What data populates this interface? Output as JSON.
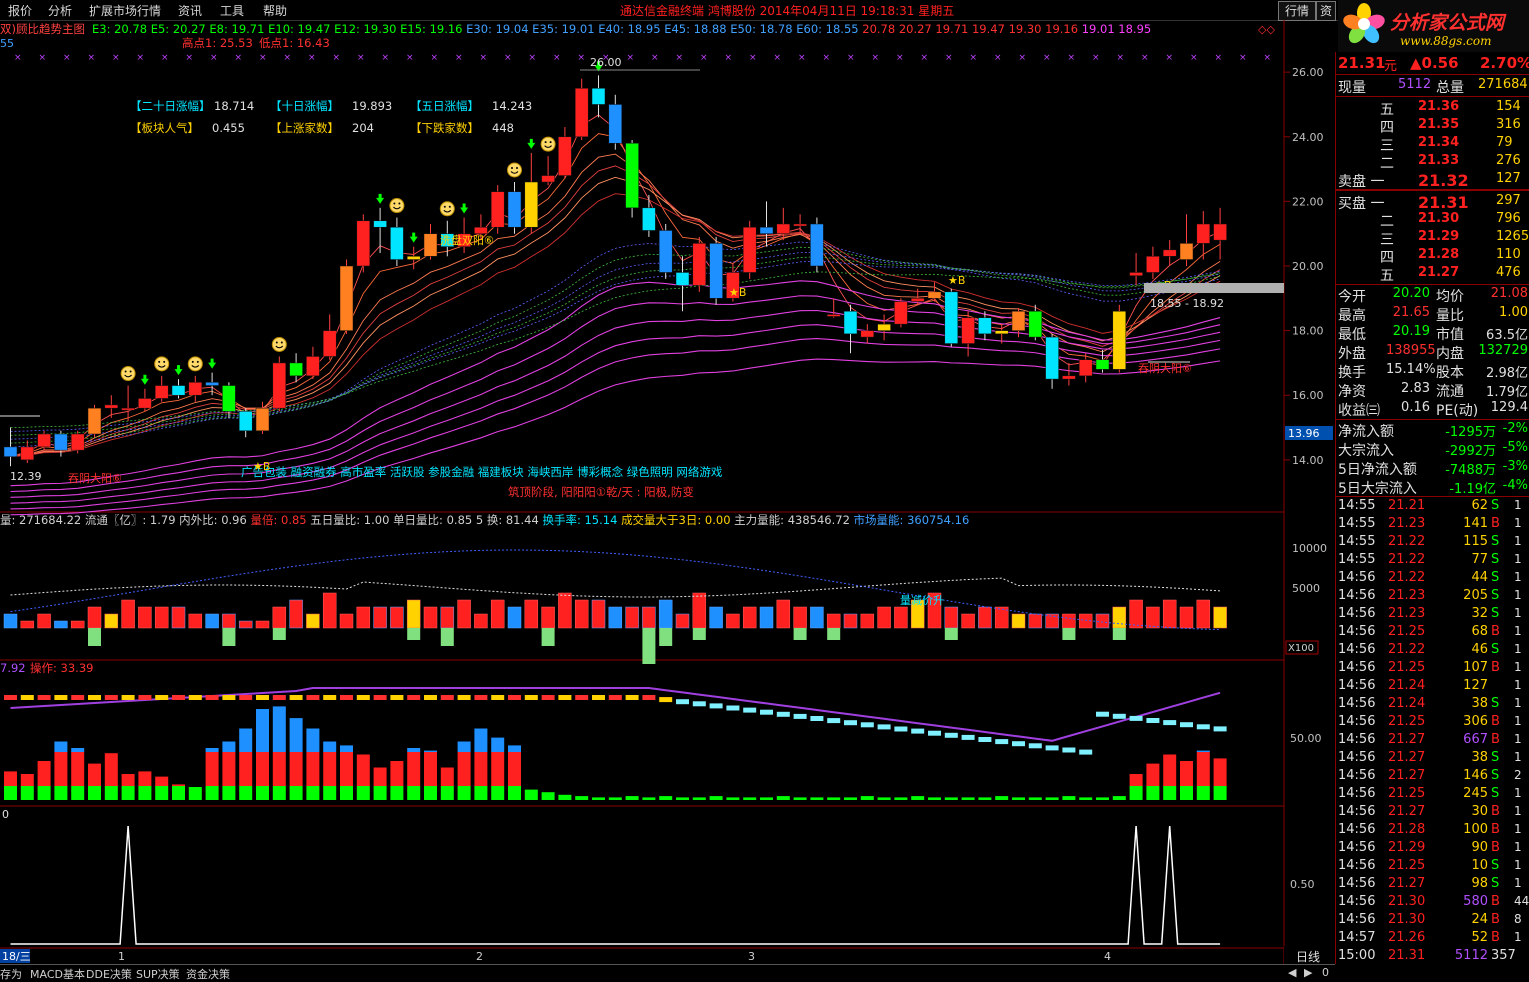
{
  "menu": [
    "报价",
    "分析",
    "扩展市场行情",
    "资讯",
    "工具",
    "帮助"
  ],
  "title_center": "通达信金融终端   鸿博股份  2014年04月11日  19:18:31  星期五",
  "buttons": {
    "hangqing": "行情",
    "zixun": "资"
  },
  "logo": {
    "text": "分析家公式网",
    "url": "www.88gs.com"
  },
  "indicator_line": {
    "name": "双)顾比趋势主图",
    "items": [
      {
        "t": "E3: 20.78",
        "c": "#00ff00"
      },
      {
        "t": "E5: 20.27",
        "c": "#00ff00"
      },
      {
        "t": "E8: 19.71",
        "c": "#00ff00"
      },
      {
        "t": "E10: 19.47",
        "c": "#00ff00"
      },
      {
        "t": "E12: 19.30",
        "c": "#00ff00"
      },
      {
        "t": "E15: 19.16",
        "c": "#00ff00"
      },
      {
        "t": "E30: 19.04",
        "c": "#40a0ff"
      },
      {
        "t": "E35: 19.01",
        "c": "#40a0ff"
      },
      {
        "t": "E40: 18.95",
        "c": "#40a0ff"
      },
      {
        "t": "E45: 18.88",
        "c": "#40a0ff"
      },
      {
        "t": "E50: 18.78",
        "c": "#40a0ff"
      },
      {
        "t": "E60: 18.55",
        "c": "#40a0ff"
      },
      {
        "t": "20.78",
        "c": "#ff3030"
      },
      {
        "t": "20.27",
        "c": "#ff3030"
      },
      {
        "t": "19.71",
        "c": "#ff3030"
      },
      {
        "t": "19.47",
        "c": "#ff3030"
      },
      {
        "t": "19.30",
        "c": "#ff3030"
      },
      {
        "t": "19.16",
        "c": "#ff3030"
      },
      {
        "t": "19.01",
        "c": "#ff40ff"
      },
      {
        "t": "18.95",
        "c": "#ff40ff"
      }
    ]
  },
  "highlow": {
    "high": "高点1: 25.53",
    "low": "低点1: 16.43"
  },
  "left_stub": "55",
  "stats_box": [
    [
      {
        "k": "【二十日涨幅】",
        "v": "18.714"
      },
      {
        "k": "【十日涨幅】",
        "v": "19.893"
      },
      {
        "k": "【五日涨幅】",
        "v": "14.243"
      }
    ],
    [
      {
        "k": "【板块人气】",
        "v": "0.455"
      },
      {
        "k": "【上涨家数】",
        "v": "204"
      },
      {
        "k": "【下跌家数】",
        "v": "448"
      }
    ]
  ],
  "annotations": {
    "peak": "26.00",
    "wash": "洗盘双阳⑥",
    "tunyin_left": "吞阴大阳⑥",
    "tunyin_right": "吞阴大阳⑥",
    "range_label": "18.55 - 18.92",
    "left_low": "12.39",
    "concepts": "广告包装 融资融券 高市盈率 活跃股 参股金融 福建板块 海峡西岸 博彩概念 绿色照明 网络游戏",
    "stage": "筑顶阶段, 阳阳阳①乾/天 : 阳极,防变",
    "star_b": "★B",
    "vol_label": "量减价升",
    "x100": "X100",
    "price_tag": "13.96"
  },
  "price_axis": [
    "26.00",
    "24.00",
    "22.00",
    "20.00",
    "18.00",
    "16.00",
    "14.00"
  ],
  "volume_line": [
    {
      "t": "量: 271684.22",
      "c": "#d0d0d0"
    },
    {
      "t": "流通〖亿〗: 1.79",
      "c": "#d0d0d0"
    },
    {
      "t": "内外比: 0.96",
      "c": "#d0d0d0"
    },
    {
      "t": "量倍: 0.85",
      "c": "#ff3030"
    },
    {
      "t": "五日量比: 1.00",
      "c": "#d0d0d0"
    },
    {
      "t": "单日量比: 0.85",
      "c": "#d0d0d0"
    },
    {
      "t": "5 换: 81.44",
      "c": "#d0d0d0"
    },
    {
      "t": "换手率: 15.14",
      "c": "#00e5ff"
    },
    {
      "t": "成交量大于3日: 0.00",
      "c": "#ffd200"
    },
    {
      "t": "主力量能: 438546.72",
      "c": "#d0d0d0"
    },
    {
      "t": "市场量能: 360754.16",
      "c": "#40a0ff"
    }
  ],
  "volume_axis": [
    "10000",
    "5000"
  ],
  "op_line": {
    "v1": "7.92",
    "label": "操作: 33.39"
  },
  "op_axis": [
    "50.00"
  ],
  "signal_axis": [
    "0.50"
  ],
  "signal_stub": "0",
  "date_axis": {
    "left": "18/三",
    "m1": "1",
    "m2": "2",
    "m3": "3",
    "m4": "4"
  },
  "bottom_tabs": [
    "存为",
    "MACD基本",
    "DDE决策",
    "SUP决策",
    "资金决策"
  ],
  "period": "日线",
  "quote": {
    "price": "21.31",
    "unit": "元",
    "change": "▲0.56",
    "pct": "2.70%",
    "xianliang_k": "现量",
    "xianliang_v": "5112",
    "zongliang_k": "总量",
    "zongliang_v": "271684",
    "asks": [
      {
        "lvl": "五",
        "p": "21.36",
        "v": "154"
      },
      {
        "lvl": "四",
        "p": "21.35",
        "v": "316"
      },
      {
        "lvl": "三",
        "p": "21.34",
        "v": "79"
      },
      {
        "lvl": "二",
        "p": "21.33",
        "v": "276"
      },
      {
        "lvl": "卖盘 一",
        "p": "21.32",
        "v": "127"
      }
    ],
    "bids": [
      {
        "lvl": "买盘 一",
        "p": "21.31",
        "v": "297"
      },
      {
        "lvl": "二",
        "p": "21.30",
        "v": "796"
      },
      {
        "lvl": "三",
        "p": "21.29",
        "v": "1265"
      },
      {
        "lvl": "四",
        "p": "21.28",
        "v": "110"
      },
      {
        "lvl": "五",
        "p": "21.27",
        "v": "476"
      }
    ],
    "stats": [
      [
        {
          "k": "今开",
          "v": "20.20",
          "c": "#00ff00"
        },
        {
          "k": "均价",
          "v": "21.08",
          "c": "#ff3030"
        }
      ],
      [
        {
          "k": "最高",
          "v": "21.65",
          "c": "#ff3030"
        },
        {
          "k": "量比",
          "v": "1.00",
          "c": "#ffd200"
        }
      ],
      [
        {
          "k": "最低",
          "v": "20.19",
          "c": "#00ff00"
        },
        {
          "k": "市值",
          "v": "63.5亿",
          "c": "#e0e0e0"
        }
      ],
      [
        {
          "k": "外盘",
          "v": "138955",
          "c": "#ff3030"
        },
        {
          "k": "内盘",
          "v": "132729",
          "c": "#00ff00"
        }
      ],
      [
        {
          "k": "换手",
          "v": "15.14%",
          "c": "#e0e0e0"
        },
        {
          "k": "股本",
          "v": "2.98亿",
          "c": "#e0e0e0"
        }
      ],
      [
        {
          "k": "净资",
          "v": "2.83",
          "c": "#e0e0e0"
        },
        {
          "k": "流通",
          "v": "1.79亿",
          "c": "#e0e0e0"
        }
      ],
      [
        {
          "k": "收益㈢",
          "v": "0.16",
          "c": "#e0e0e0"
        },
        {
          "k": "PE(动)",
          "v": "129.4",
          "c": "#e0e0e0"
        }
      ]
    ],
    "flows": [
      {
        "k": "净流入额",
        "v": "-1295万",
        "p": "-2%"
      },
      {
        "k": "大宗流入",
        "v": "-2992万",
        "p": "-5%"
      },
      {
        "k": "5日净流入额",
        "v": "-7488万",
        "p": "-3%"
      },
      {
        "k": "5日大宗流入",
        "v": "-1.19亿",
        "p": "-4%"
      }
    ],
    "ticks": [
      {
        "t": "14:55",
        "p": "21.21",
        "v": "62",
        "d": "S"
      },
      {
        "t": "14:55",
        "p": "21.23",
        "v": "141",
        "d": "B"
      },
      {
        "t": "14:55",
        "p": "21.22",
        "v": "115",
        "d": "S"
      },
      {
        "t": "14:55",
        "p": "21.22",
        "v": "77",
        "d": "S"
      },
      {
        "t": "14:56",
        "p": "21.22",
        "v": "44",
        "d": "S"
      },
      {
        "t": "14:56",
        "p": "21.23",
        "v": "205",
        "d": "S"
      },
      {
        "t": "14:56",
        "p": "21.23",
        "v": "32",
        "d": "S"
      },
      {
        "t": "14:56",
        "p": "21.25",
        "v": "68",
        "d": "B"
      },
      {
        "t": "14:56",
        "p": "21.22",
        "v": "46",
        "d": "S"
      },
      {
        "t": "14:56",
        "p": "21.25",
        "v": "107",
        "d": "B"
      },
      {
        "t": "14:56",
        "p": "21.24",
        "v": "127",
        "d": ""
      },
      {
        "t": "14:56",
        "p": "21.24",
        "v": "38",
        "d": "S"
      },
      {
        "t": "14:56",
        "p": "21.25",
        "v": "306",
        "d": "B"
      },
      {
        "t": "14:56",
        "p": "21.27",
        "v": "667",
        "d": "B"
      },
      {
        "t": "14:56",
        "p": "21.27",
        "v": "38",
        "d": "S"
      },
      {
        "t": "14:56",
        "p": "21.27",
        "v": "146",
        "d": "S"
      },
      {
        "t": "14:56",
        "p": "21.25",
        "v": "245",
        "d": "S"
      },
      {
        "t": "14:56",
        "p": "21.27",
        "v": "30",
        "d": "B"
      },
      {
        "t": "14:56",
        "p": "21.28",
        "v": "100",
        "d": "B"
      },
      {
        "t": "14:56",
        "p": "21.29",
        "v": "90",
        "d": "B"
      },
      {
        "t": "14:56",
        "p": "21.25",
        "v": "10",
        "d": "S"
      },
      {
        "t": "14:56",
        "p": "21.27",
        "v": "98",
        "d": "S"
      },
      {
        "t": "14:56",
        "p": "21.30",
        "v": "580",
        "d": "B"
      },
      {
        "t": "14:56",
        "p": "21.30",
        "v": "24",
        "d": "B"
      },
      {
        "t": "14:57",
        "p": "21.26",
        "v": "52",
        "d": "B"
      },
      {
        "t": "15:00",
        "p": "21.31",
        "v": "5112",
        "d": "357"
      }
    ],
    "tick_tail": [
      "1",
      "1",
      "1",
      "1",
      "1",
      "1",
      "1",
      "1",
      "1",
      "1",
      "1",
      "1",
      "1",
      "1",
      "1",
      "2",
      "1",
      "1",
      "1",
      "1",
      "1",
      "1",
      "44",
      "8",
      "1",
      ""
    ]
  },
  "colors": {
    "up": "#ff2020",
    "down": "#00ff00",
    "flat": "#ffd200",
    "blue": "#1e90ff",
    "magenta": "#ff40ff"
  },
  "chart_data": {
    "type": "candlestick",
    "price_range": [
      13.5,
      26.5
    ],
    "candles": [
      [
        14.4,
        14.1,
        15.0,
        13.8
      ],
      [
        14.0,
        14.4,
        14.6,
        13.9
      ],
      [
        14.4,
        14.8,
        14.9,
        14.3
      ],
      [
        14.8,
        14.3,
        14.9,
        14.1
      ],
      [
        14.3,
        14.8,
        14.9,
        14.2
      ],
      [
        14.8,
        15.6,
        15.7,
        14.7
      ],
      [
        15.6,
        15.7,
        16.0,
        15.3
      ],
      [
        15.6,
        15.6,
        16.3,
        15.2
      ],
      [
        15.6,
        15.9,
        16.2,
        15.5
      ],
      [
        15.9,
        16.3,
        16.6,
        15.8
      ],
      [
        16.3,
        16.0,
        16.5,
        15.9
      ],
      [
        16.0,
        16.4,
        16.6,
        15.8
      ],
      [
        16.4,
        16.3,
        16.7,
        16.0
      ],
      [
        16.3,
        15.5,
        16.4,
        15.3
      ],
      [
        15.5,
        14.9,
        15.6,
        14.7
      ],
      [
        14.9,
        15.6,
        15.8,
        14.8
      ],
      [
        15.6,
        17.0,
        17.2,
        15.5
      ],
      [
        17.0,
        16.6,
        17.3,
        16.4
      ],
      [
        16.6,
        17.2,
        17.5,
        16.5
      ],
      [
        17.2,
        18.0,
        18.5,
        17.1
      ],
      [
        18.0,
        20.0,
        20.2,
        17.9
      ],
      [
        20.0,
        21.4,
        21.6,
        19.8
      ],
      [
        21.4,
        21.2,
        21.8,
        20.4
      ],
      [
        21.2,
        20.2,
        21.5,
        20.0
      ],
      [
        20.2,
        20.3,
        20.6,
        19.9
      ],
      [
        20.3,
        21.0,
        21.3,
        20.2
      ],
      [
        21.0,
        20.6,
        21.4,
        20.3
      ],
      [
        20.6,
        21.0,
        21.5,
        20.4
      ],
      [
        21.0,
        21.2,
        21.6,
        20.8
      ],
      [
        21.2,
        22.3,
        22.5,
        21.0
      ],
      [
        22.3,
        21.2,
        22.6,
        21.0
      ],
      [
        21.2,
        22.6,
        23.5,
        21.0
      ],
      [
        22.6,
        22.8,
        23.4,
        22.5
      ],
      [
        22.8,
        24.0,
        24.3,
        22.7
      ],
      [
        24.0,
        25.5,
        25.8,
        23.9
      ],
      [
        25.5,
        25.0,
        25.9,
        24.6
      ],
      [
        25.0,
        23.8,
        25.3,
        23.6
      ],
      [
        23.8,
        21.8,
        23.9,
        21.5
      ],
      [
        21.8,
        21.1,
        22.2,
        20.9
      ],
      [
        21.1,
        19.8,
        21.3,
        19.6
      ],
      [
        19.8,
        19.4,
        20.3,
        18.6
      ],
      [
        19.4,
        20.7,
        20.9,
        19.2
      ],
      [
        20.7,
        19.0,
        20.9,
        18.8
      ],
      [
        19.0,
        19.8,
        20.1,
        18.9
      ],
      [
        19.8,
        21.2,
        21.4,
        19.6
      ],
      [
        21.2,
        21.0,
        22.0,
        20.6
      ],
      [
        21.0,
        21.3,
        21.8,
        20.8
      ],
      [
        21.3,
        21.3,
        21.6,
        21.0
      ],
      [
        21.3,
        20.0,
        21.5,
        19.8
      ],
      [
        18.5,
        18.5,
        19.0,
        18.4
      ],
      [
        18.6,
        17.9,
        18.8,
        17.3
      ],
      [
        17.8,
        18.0,
        18.2,
        17.6
      ],
      [
        18.0,
        18.2,
        18.5,
        17.7
      ],
      [
        18.2,
        18.9,
        19.0,
        18.1
      ],
      [
        18.9,
        19.0,
        19.3,
        18.8
      ],
      [
        19.0,
        19.2,
        19.5,
        18.9
      ],
      [
        19.2,
        17.6,
        19.3,
        17.5
      ],
      [
        17.6,
        18.4,
        18.6,
        17.2
      ],
      [
        18.4,
        17.9,
        18.6,
        17.7
      ],
      [
        17.9,
        18.0,
        18.2,
        17.6
      ],
      [
        18.0,
        18.6,
        18.7,
        17.8
      ],
      [
        18.6,
        17.8,
        18.8,
        17.7
      ],
      [
        17.8,
        16.5,
        17.9,
        16.2
      ],
      [
        16.5,
        16.6,
        17.0,
        16.3
      ],
      [
        16.6,
        17.1,
        17.3,
        16.4
      ],
      [
        17.1,
        16.8,
        17.4,
        16.7
      ],
      [
        16.8,
        18.6,
        18.8,
        16.7
      ],
      [
        19.7,
        19.8,
        20.4,
        19.4
      ],
      [
        19.8,
        20.3,
        20.6,
        19.6
      ],
      [
        20.3,
        20.5,
        20.8,
        20.0
      ],
      [
        20.2,
        20.7,
        21.6,
        20.0
      ],
      [
        20.7,
        21.3,
        21.7,
        20.2
      ],
      [
        20.8,
        21.3,
        21.8,
        20.2
      ]
    ],
    "volumes": [
      2,
      1,
      2,
      1,
      1,
      3,
      2,
      4,
      3,
      3,
      3,
      2,
      2,
      2,
      1,
      1,
      3,
      4,
      2,
      5,
      2,
      3,
      3,
      3,
      4,
      3,
      3,
      4,
      2,
      4,
      3,
      4,
      3,
      5,
      4,
      4,
      3,
      3,
      3,
      4,
      2,
      5,
      3,
      2,
      3,
      3,
      4,
      3,
      3,
      2,
      2,
      2,
      3,
      3,
      4,
      5,
      3,
      2,
      3,
      3,
      2,
      2,
      2,
      2,
      2,
      2,
      3,
      4,
      3,
      4,
      3,
      4,
      3
    ],
    "vol_neg": {
      "5": 3,
      "13": 3,
      "16": 2,
      "24": 2,
      "26": 3,
      "32": 3,
      "38": 6,
      "39": 3,
      "41": 2,
      "47": 2,
      "49": 2,
      "56": 2,
      "63": 2,
      "66": 2
    },
    "op_bars": [
      22,
      20,
      30,
      45,
      40,
      28,
      36,
      20,
      22,
      18,
      12,
      10,
      40,
      45,
      55,
      70,
      72,
      63,
      55,
      45,
      42,
      35,
      25,
      30,
      40,
      38,
      25,
      45,
      55,
      48,
      42,
      8,
      6,
      4,
      3,
      2,
      2,
      3,
      2,
      3,
      2,
      2,
      3,
      2,
      2,
      2,
      3,
      2,
      2,
      2,
      2,
      3,
      2,
      2,
      3,
      2,
      2,
      2,
      2,
      3,
      2,
      2,
      2,
      3,
      2,
      2,
      3,
      20,
      28,
      35,
      30,
      38,
      32
    ],
    "signal_spikes": [
      7,
      67,
      69
    ]
  }
}
